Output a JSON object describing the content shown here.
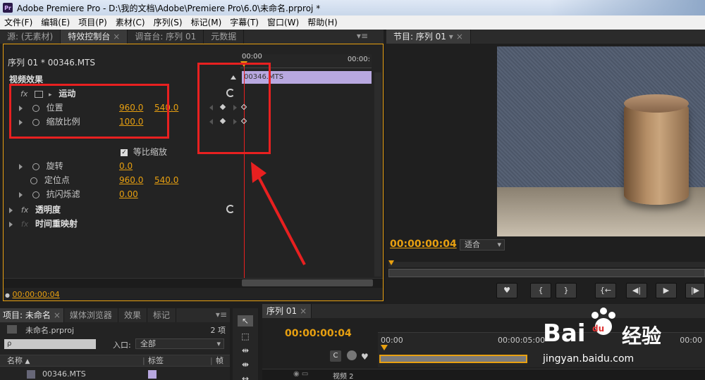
{
  "window": {
    "logo": "Pr",
    "title": "Adobe Premiere Pro - D:\\我的文档\\Adobe\\Premiere Pro\\6.0\\未命名.prproj *"
  },
  "menu": [
    "文件(F)",
    "编辑(E)",
    "项目(P)",
    "素材(C)",
    "序列(S)",
    "标记(M)",
    "字幕(T)",
    "窗口(W)",
    "帮助(H)"
  ],
  "source_tabs": {
    "source": "源: (无素材)",
    "effect_controls": "特效控制台",
    "mixer": "调音台: 序列 01",
    "metadata": "元数据"
  },
  "effect_controls": {
    "clip_header": "序列 01 * 00346.MTS",
    "time_start": "00:00",
    "time_end": "00:00:",
    "clip_bar": "00346.MTS",
    "video_effects": "视频效果",
    "motion": "运动",
    "position_label": "位置",
    "position_x": "960.0",
    "position_y": "540.0",
    "scale_label": "缩放比例",
    "scale_value": "100.0",
    "uniform_scale": "等比缩放",
    "rotation_label": "旋转",
    "rotation_value": "0.0",
    "anchor_label": "定位点",
    "anchor_x": "960.0",
    "anchor_y": "540.0",
    "antiflicker_label": "抗闪烁滤",
    "antiflicker_value": "0.00",
    "opacity": "透明度",
    "time_remap": "时间重映射",
    "timecode": "00:00:00:04"
  },
  "program": {
    "tab": "节目: 序列 01",
    "timecode": "00:00:00:04",
    "fit": "适合"
  },
  "project": {
    "tabs": [
      "项目: 未命名",
      "媒体浏览器",
      "效果",
      "标记"
    ],
    "project_file": "未命名.prproj",
    "item_count": "2 项",
    "search_icon_text": "ρ",
    "entry_label": "入口:",
    "entry_value": "全部",
    "col_name": "名称",
    "col_label": "标签",
    "col_fps": "帧",
    "item": "00346.MTS"
  },
  "timeline": {
    "tab": "序列 01",
    "timecode": "00:00:00:04",
    "ruler_start": "00:00",
    "ruler_mid": "00:00:05:00",
    "ruler_end": "00:00",
    "track": "视频 2"
  },
  "watermark": {
    "brand": "Bai",
    "du": "du",
    "jingyan": "经验",
    "url": "jingyan.baidu.com"
  },
  "colors": {
    "accent": "#e8a010",
    "annotation": "#e82020",
    "clip": "#b8a8e0"
  }
}
